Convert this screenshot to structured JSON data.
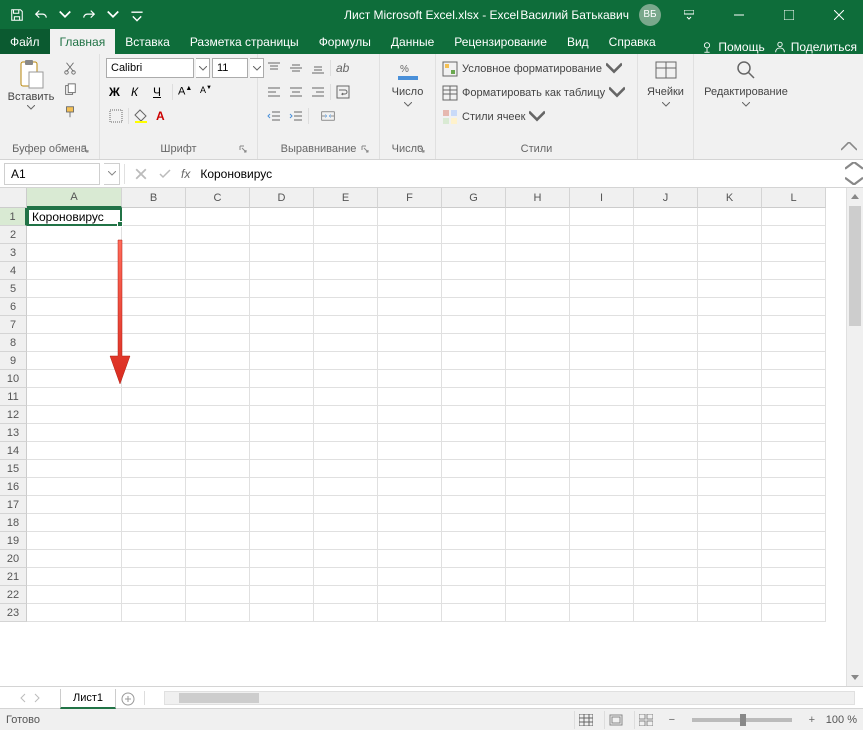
{
  "titlebar": {
    "document_title": "Лист Microsoft Excel.xlsx  -  Excel",
    "user_name": "Василий Батькавич",
    "user_initials": "ВБ"
  },
  "tabs": {
    "file": "Файл",
    "items": [
      "Главная",
      "Вставка",
      "Разметка страницы",
      "Формулы",
      "Данные",
      "Рецензирование",
      "Вид",
      "Справка"
    ],
    "active_index": 0,
    "help_label": "Помощь",
    "share_label": "Поделиться"
  },
  "ribbon": {
    "clipboard": {
      "paste": "Вставить",
      "label": "Буфер обмена"
    },
    "font": {
      "name": "Calibri",
      "size": "11",
      "bold": "Ж",
      "italic": "К",
      "underline": "Ч",
      "label": "Шрифт"
    },
    "alignment": {
      "label": "Выравнивание"
    },
    "number": {
      "btn": "Число",
      "label": "Число"
    },
    "styles": {
      "conditional": "Условное форматирование",
      "table": "Форматировать как таблицу",
      "cell_styles": "Стили ячеек",
      "label": "Стили"
    },
    "cells": {
      "btn": "Ячейки"
    },
    "editing": {
      "btn": "Редактирование"
    }
  },
  "formula_bar": {
    "name_box": "A1",
    "formula": "Короновирус"
  },
  "grid": {
    "columns": [
      "A",
      "B",
      "C",
      "D",
      "E",
      "F",
      "G",
      "H",
      "I",
      "J",
      "K",
      "L"
    ],
    "rows": [
      1,
      2,
      3,
      4,
      5,
      6,
      7,
      8,
      9,
      10,
      11,
      12,
      13,
      14,
      15,
      16,
      17,
      18,
      19,
      20,
      21,
      22,
      23
    ],
    "active_cell_value": "Короновирус"
  },
  "sheets": {
    "tab": "Лист1"
  },
  "statusbar": {
    "ready": "Готово",
    "zoom": "100 %"
  }
}
